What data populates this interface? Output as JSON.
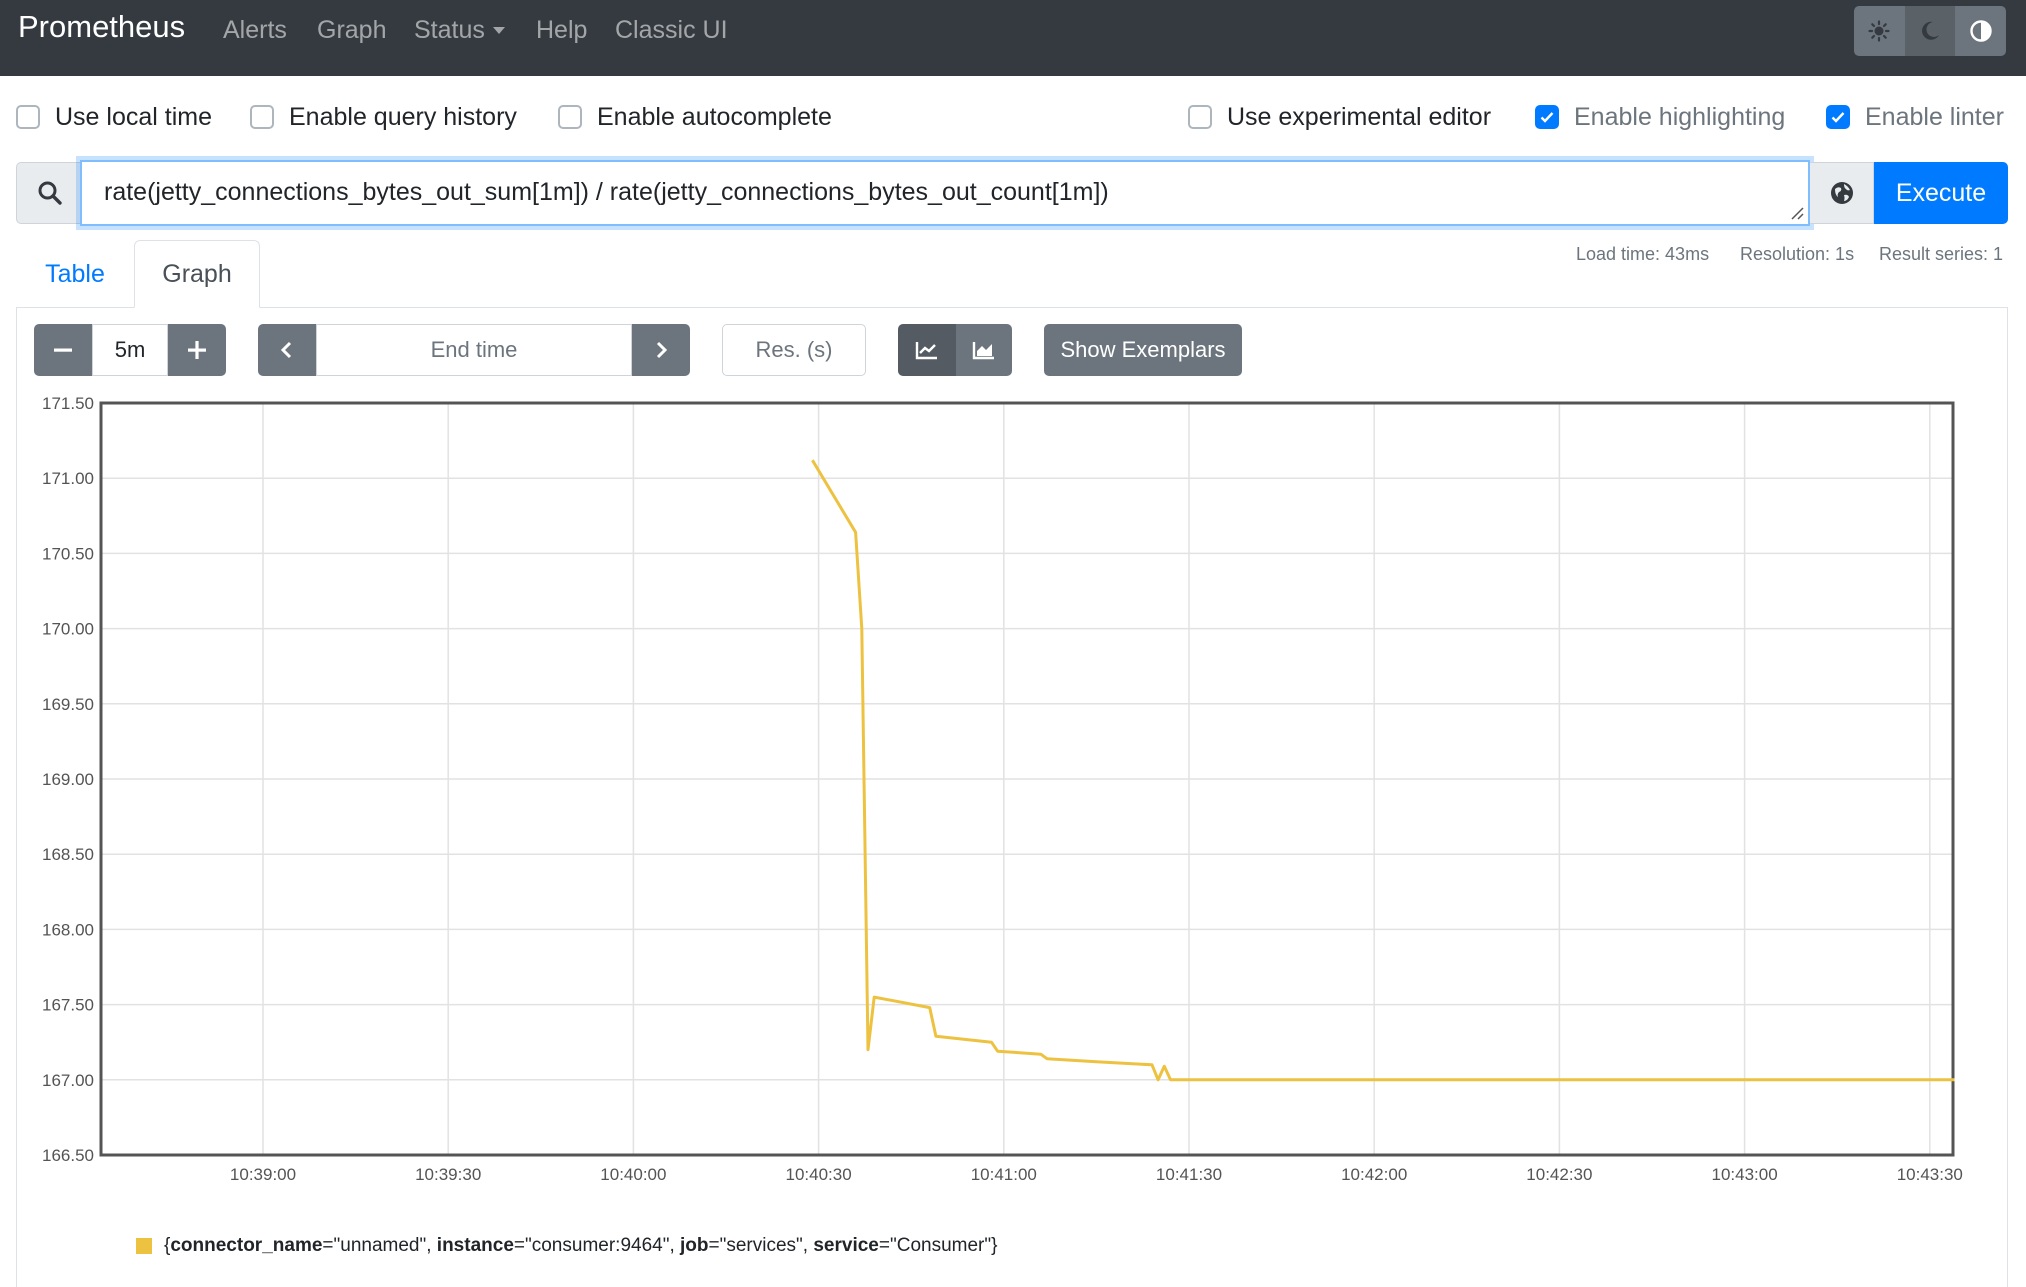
{
  "app": {
    "brand": "Prometheus",
    "nav": [
      {
        "label": "Alerts"
      },
      {
        "label": "Graph"
      },
      {
        "label": "Status"
      },
      {
        "label": "Help"
      },
      {
        "label": "Classic UI"
      }
    ],
    "theme_buttons": [
      {
        "name": "light-theme-button",
        "icon": "sun-icon"
      },
      {
        "name": "dark-theme-button",
        "icon": "moon-icon"
      },
      {
        "name": "auto-theme-button",
        "icon": "half-circle-icon"
      }
    ]
  },
  "options": [
    {
      "label": "Use local time",
      "checked": false
    },
    {
      "label": "Enable query history",
      "checked": false
    },
    {
      "label": "Enable autocomplete",
      "checked": false
    },
    {
      "label": "Use experimental editor",
      "checked": false
    },
    {
      "label": "Enable highlighting",
      "checked": true
    },
    {
      "label": "Enable linter",
      "checked": true
    }
  ],
  "query": {
    "expression": "rate(jetty_connections_bytes_out_sum[1m]) / rate(jetty_connections_bytes_out_count[1m])",
    "execute_label": "Execute"
  },
  "tabs": [
    {
      "label": "Table",
      "active": false
    },
    {
      "label": "Graph",
      "active": true
    }
  ],
  "stats": {
    "load_time": "Load time: 43ms",
    "resolution": "Resolution: 1s",
    "result_series": "Result series: 1"
  },
  "graph_controls": {
    "range": "5m",
    "end_time_placeholder": "End time",
    "resolution_placeholder": "Res. (s)",
    "show_exemplars": "Show Exemplars",
    "stacked": false
  },
  "colors": {
    "navbar": "#343a40",
    "primary": "#007bff",
    "series": "#edc240",
    "secondary": "#6c757d"
  },
  "chart_data": {
    "type": "line",
    "title": "",
    "xlabel": "",
    "ylabel": "",
    "ylim": [
      166.5,
      171.5
    ],
    "yticks": [
      "171.50",
      "171.00",
      "170.50",
      "170.00",
      "169.50",
      "169.00",
      "168.50",
      "168.00",
      "167.50",
      "167.00",
      "166.50"
    ],
    "xticks": [
      "10:39:00",
      "10:39:30",
      "10:40:00",
      "10:40:30",
      "10:41:00",
      "10:41:30",
      "10:42:00",
      "10:42:30",
      "10:43:00",
      "10:43:30"
    ],
    "grid": true,
    "series": [
      {
        "name": "{connector_name=\"unnamed\", instance=\"consumer:9464\", job=\"services\", service=\"Consumer\"}",
        "legend_parts": [
          {
            "key": "connector_name",
            "value": "\"unnamed\", "
          },
          {
            "key": "instance",
            "value": "\"consumer:9464\", "
          },
          {
            "key": "job",
            "value": "\"services\", "
          },
          {
            "key": "service",
            "value": "\"Consumer\"}"
          }
        ],
        "points": [
          [
            "10:40:29",
            171.12
          ],
          [
            "10:40:36",
            170.64
          ],
          [
            "10:40:37",
            170.0
          ],
          [
            "10:40:38",
            167.2
          ],
          [
            "10:40:39",
            167.55
          ],
          [
            "10:40:48",
            167.48
          ],
          [
            "10:40:49",
            167.29
          ],
          [
            "10:40:58",
            167.25
          ],
          [
            "10:40:59",
            167.19
          ],
          [
            "10:41:06",
            167.17
          ],
          [
            "10:41:07",
            167.14
          ],
          [
            "10:41:15",
            167.12
          ],
          [
            "10:41:24",
            167.1
          ],
          [
            "10:41:25",
            167.0
          ],
          [
            "10:41:26",
            167.09
          ],
          [
            "10:41:27",
            167.0
          ],
          [
            "10:43:34",
            167.0
          ]
        ]
      }
    ]
  }
}
